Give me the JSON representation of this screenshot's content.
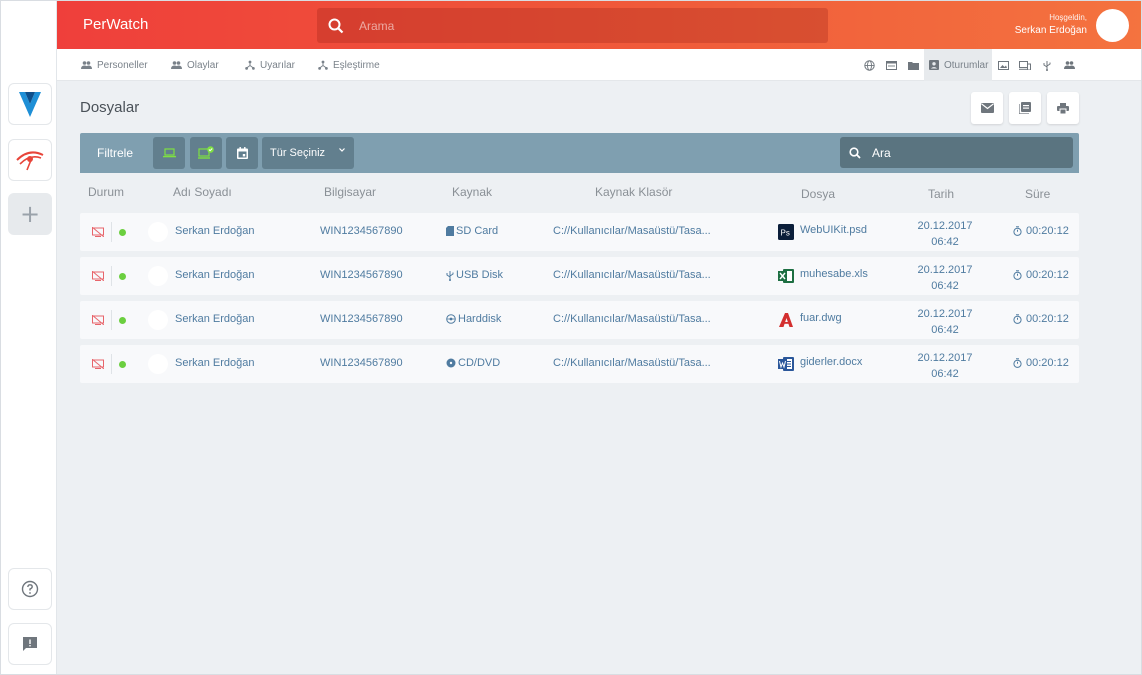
{
  "app": {
    "title": "PerWatch"
  },
  "header": {
    "search_placeholder": "Arama",
    "welcome": "Hoşgeldin,",
    "user_name": "Serkan Erdoğan"
  },
  "nav": {
    "items": [
      {
        "label": "Personeller",
        "icon": "people-icon"
      },
      {
        "label": "Olaylar",
        "icon": "people-icon"
      },
      {
        "label": "Uyarılar",
        "icon": "hub-icon"
      },
      {
        "label": "Eşleştirme",
        "icon": "hub-icon"
      }
    ],
    "active_label": "Oturumlar"
  },
  "page": {
    "title": "Dosyalar"
  },
  "filter": {
    "label": "Filtrele",
    "type_select": "Tür Seçiniz",
    "search_placeholder": "Ara"
  },
  "table": {
    "headers": [
      "Durum",
      "Adı Soyadı",
      "Bilgisayar",
      "Kaynak",
      "Kaynak Klasör",
      "Dosya",
      "Tarih",
      "Süre"
    ],
    "rows": [
      {
        "name": "Serkan Erdoğan",
        "computer": "WIN1234567890",
        "source": "SD Card",
        "source_icon": "sd-card-icon",
        "folder": "C://Kullanıcılar/Masaüstü/Tasa...",
        "file": "WebUIKit.psd",
        "file_icon": "photoshop-icon",
        "date": "20.12.2017",
        "time": "06:42",
        "duration": "00:20:12"
      },
      {
        "name": "Serkan Erdoğan",
        "computer": "WIN1234567890",
        "source": "USB Disk",
        "source_icon": "usb-icon",
        "folder": "C://Kullanıcılar/Masaüstü/Tasa...",
        "file": "muhesabe.xls",
        "file_icon": "excel-icon",
        "date": "20.12.2017",
        "time": "06:42",
        "duration": "00:20:12"
      },
      {
        "name": "Serkan Erdoğan",
        "computer": "WIN1234567890",
        "source": "Harddisk",
        "source_icon": "harddisk-icon",
        "folder": "C://Kullanıcılar/Masaüstü/Tasa...",
        "file": "fuar.dwg",
        "file_icon": "autocad-icon",
        "date": "20.12.2017",
        "time": "06:42",
        "duration": "00:20:12"
      },
      {
        "name": "Serkan Erdoğan",
        "computer": "WIN1234567890",
        "source": "CD/DVD",
        "source_icon": "cd-dvd-icon",
        "folder": "C://Kullanıcılar/Masaüstü/Tasa...",
        "file": "giderler.docx",
        "file_icon": "word-icon",
        "date": "20.12.2017",
        "time": "06:42",
        "duration": "00:20:12"
      }
    ]
  },
  "colors": {
    "header_start": "#ef3f3b",
    "header_end": "#f4733f",
    "filter_bar": "#7f9fb0",
    "text_link": "#4f7ba0",
    "status_online": "#6bcf3f"
  }
}
